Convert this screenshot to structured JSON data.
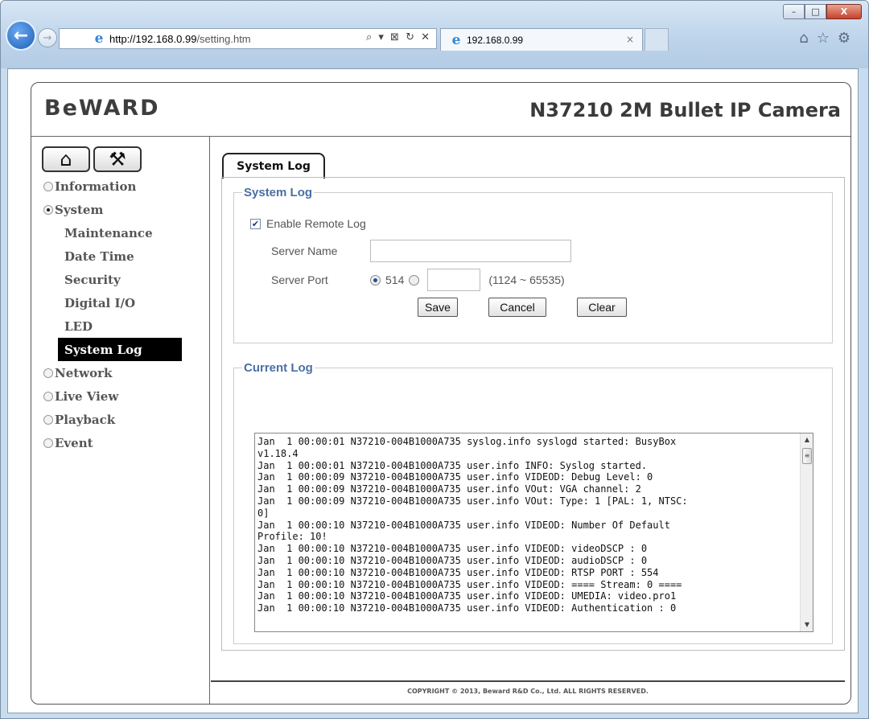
{
  "browser": {
    "url_host": "http://192.168.0.99",
    "url_path": "/setting.htm",
    "address_tools": "⌕ ▾ ⊠ ↻ ✕",
    "tab_title": "192.168.0.99",
    "tab_close": "×",
    "window_buttons": {
      "minimize": "–",
      "maximize": "□",
      "close": "X"
    },
    "right_icons": "⌂☆⚙"
  },
  "header": {
    "logo": "BeWARD",
    "model_title": "N37210 2M Bullet IP Camera"
  },
  "sidebar": {
    "home_icon": "⌂",
    "tools_icon": "⚒",
    "items": [
      {
        "label": "Information",
        "expanded": false
      },
      {
        "label": "System",
        "expanded": true
      },
      {
        "label": "Network",
        "expanded": false
      },
      {
        "label": "Live View",
        "expanded": false
      },
      {
        "label": "Playback",
        "expanded": false
      },
      {
        "label": "Event",
        "expanded": false
      }
    ],
    "system_sub": [
      "Maintenance",
      "Date Time",
      "Security",
      "Digital I/O",
      "LED",
      "System Log"
    ],
    "active_sub": "System Log"
  },
  "content": {
    "tab_label": "System Log",
    "system_log_group": {
      "legend": "System Log",
      "enable_remote_log": {
        "label": "Enable Remote Log",
        "checked": true,
        "mark": "✔"
      },
      "server_name": {
        "label": "Server Name",
        "value": ""
      },
      "server_port": {
        "label": "Server Port",
        "default_option": "514",
        "custom_value": "",
        "range": "(1124 ~ 65535)"
      },
      "buttons": {
        "save": "Save",
        "cancel": "Cancel",
        "clear": "Clear"
      }
    },
    "current_log_group": {
      "legend": "Current Log",
      "lines": [
        "Jan  1 00:00:01 N37210-004B1000A735 syslog.info syslogd started: BusyBox",
        "v1.18.4",
        "Jan  1 00:00:01 N37210-004B1000A735 user.info INFO: Syslog started.",
        "Jan  1 00:00:09 N37210-004B1000A735 user.info VIDEOD: Debug Level: 0",
        "Jan  1 00:00:09 N37210-004B1000A735 user.info VOut: VGA channel: 2",
        "Jan  1 00:00:09 N37210-004B1000A735 user.info VOut: Type: 1 [PAL: 1, NTSC:",
        "0]",
        "Jan  1 00:00:10 N37210-004B1000A735 user.info VIDEOD: Number Of Default",
        "Profile: 10!",
        "Jan  1 00:00:10 N37210-004B1000A735 user.info VIDEOD: videoDSCP : 0",
        "Jan  1 00:00:10 N37210-004B1000A735 user.info VIDEOD: audioDSCP : 0",
        "Jan  1 00:00:10 N37210-004B1000A735 user.info VIDEOD: RTSP PORT : 554",
        "Jan  1 00:00:10 N37210-004B1000A735 user.info VIDEOD: ==== Stream: 0 ====",
        "Jan  1 00:00:10 N37210-004B1000A735 user.info VIDEOD: UMEDIA: video.pro1",
        "Jan  1 00:00:10 N37210-004B1000A735 user.info VIDEOD: Authentication : 0"
      ]
    }
  },
  "footer": "COPYRIGHT © 2013, Beward R&D Co., Ltd. ALL RIGHTS RESERVED."
}
